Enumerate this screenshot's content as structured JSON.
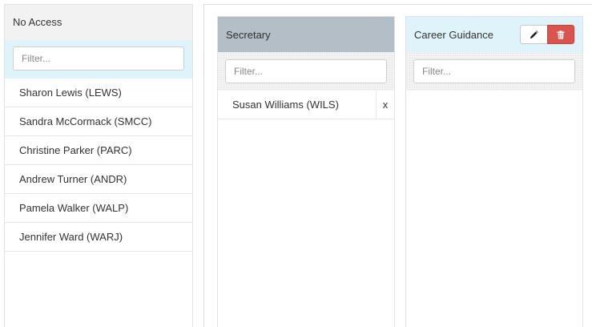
{
  "left_panel": {
    "title": "No Access",
    "filter_placeholder": "Filter...",
    "users": [
      "Sharon Lewis (LEWS)",
      "Sandra McCormack (SMCC)",
      "Christine Parker (PARC)",
      "Andrew Turner (ANDR)",
      "Pamela Walker (WALP)",
      "Jennifer Ward (WARJ)"
    ]
  },
  "groups": [
    {
      "title": "Secretary",
      "filter_placeholder": "Filter...",
      "members": [
        {
          "name": "Susan Williams (WILS)",
          "remove_label": "x"
        }
      ]
    },
    {
      "title": "Career Guidance",
      "filter_placeholder": "Filter...",
      "members": [],
      "actions": {
        "edit_icon": "pencil-icon",
        "delete_icon": "trash-icon"
      }
    }
  ],
  "colors": {
    "selected_header": "#b3bec6",
    "light_blue": "#dff3fb",
    "delete_red": "#d9534f"
  }
}
